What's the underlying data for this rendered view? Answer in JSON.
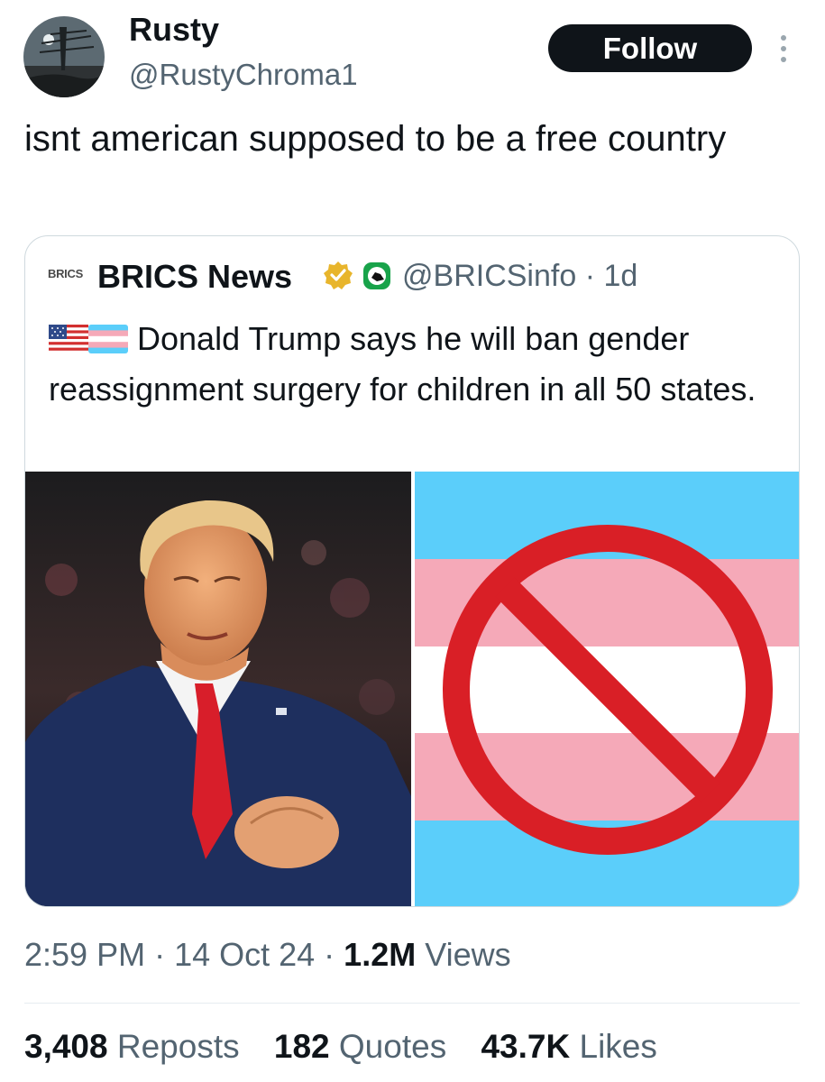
{
  "author": {
    "name": "Rusty",
    "handle": "@RustyChroma1",
    "follow_label": "Follow"
  },
  "tweet": {
    "text": "isnt american supposed to be a free country"
  },
  "quote": {
    "logo_text": "BRICS",
    "name": "BRICS News",
    "handle_and_time": "@BRICSinfo · 1d",
    "text": "Donald Trump says he will ban gender reassignment surgery for children in all 50 states.",
    "flag_emojis": [
      "us-flag-icon",
      "transgender-flag-icon"
    ],
    "images": [
      "trump-photo",
      "banned-trans-flag"
    ]
  },
  "meta": {
    "time": "2:59 PM",
    "sep1": " · ",
    "date": "14 Oct 24",
    "sep2": " · ",
    "views_count": "1.2M",
    "views_label": " Views"
  },
  "stats": {
    "reposts_count": "3,408",
    "reposts_label": " Reposts",
    "quotes_count": "182",
    "quotes_label": " Quotes",
    "likes_count": "43.7K",
    "likes_label": " Likes"
  },
  "colors": {
    "trans_blue": "#5bcefa",
    "trans_pink": "#f5a9b8",
    "ban_red": "#d91f26",
    "follow_bg": "#0f1419"
  }
}
